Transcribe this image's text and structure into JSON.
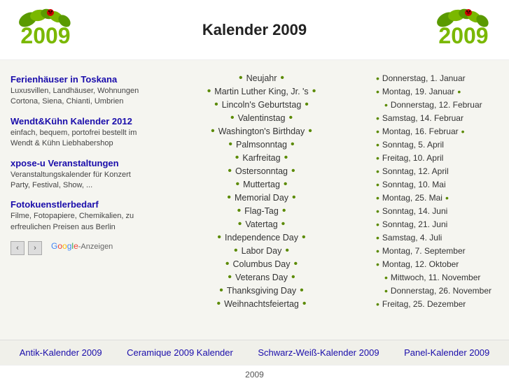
{
  "header": {
    "title": "Kalender 2009"
  },
  "sidebar": {
    "ads": [
      {
        "link": "Ferienhäuser in Toskana",
        "text": "Luxusvillen, Landhäuser, Wohnungen Cortona, Siena, Chianti, Umbrien",
        "url": "#"
      },
      {
        "link": "Wendt&Kühn Kalender 2012",
        "text": "einfach, bequem, portofrei bestellt im Wendt & Kühn Liebhabershop",
        "url": "#"
      },
      {
        "link": "xpose-u Veranstaltungen",
        "text": "Veranstaltungskalender für Konzert Party, Festival, Show, ...",
        "url": "#"
      },
      {
        "link": "Fotokuenstlerbedarf",
        "text": "Filme, Fotopapiere, Chemikalien, zu erfreulichen Preisen aus Berlin",
        "url": "#"
      }
    ],
    "google_anzeigen": "Google-Anzeigen",
    "nav_prev": "‹",
    "nav_next": "›"
  },
  "middle": {
    "holidays": [
      "Neujahr",
      "Martin Luther King, Jr. 's",
      "Lincoln's Geburtstag",
      "Valentinstag",
      "Washington's Birthday",
      "Palmsonntag",
      "Karfreitag",
      "Ostersonntag",
      "Muttertag",
      "Memorial Day",
      "Flag-Tag",
      "Vatertag",
      "Independence Day",
      "Labor Day",
      "Columbus Day",
      "Veterans Day",
      "Thanksgiving Day",
      "Weihnachtsfeiertag"
    ]
  },
  "right": {
    "dates": [
      {
        "text": "Donnerstag, 1. Januar",
        "indent": false,
        "bullet_right": false
      },
      {
        "text": "Montag, 19. Januar",
        "indent": false,
        "bullet_right": true
      },
      {
        "text": "Donnerstag, 12. Februar",
        "indent": true,
        "bullet_right": false
      },
      {
        "text": "Samstag, 14. Februar",
        "indent": false,
        "bullet_right": false
      },
      {
        "text": "Montag, 16. Februar",
        "indent": false,
        "bullet_right": true
      },
      {
        "text": "Sonntag, 5. April",
        "indent": false,
        "bullet_right": false
      },
      {
        "text": "Freitag, 10. April",
        "indent": false,
        "bullet_right": false
      },
      {
        "text": "Sonntag, 12. April",
        "indent": false,
        "bullet_right": false
      },
      {
        "text": "Sonntag, 10. Mai",
        "indent": false,
        "bullet_right": false
      },
      {
        "text": "Montag, 25. Mai",
        "indent": false,
        "bullet_right": true
      },
      {
        "text": "Sonntag, 14. Juni",
        "indent": false,
        "bullet_right": false
      },
      {
        "text": "Sonntag, 21. Juni",
        "indent": false,
        "bullet_right": false
      },
      {
        "text": "Samstag, 4. Juli",
        "indent": false,
        "bullet_right": false
      },
      {
        "text": "Montag, 7. September",
        "indent": false,
        "bullet_right": false
      },
      {
        "text": "Montag, 12. Oktober",
        "indent": false,
        "bullet_right": false
      },
      {
        "text": "Mittwoch, 11. November",
        "indent": true,
        "bullet_right": false
      },
      {
        "text": "Donnerstag, 26. November",
        "indent": true,
        "bullet_right": false
      },
      {
        "text": "Freitag, 25. Dezember",
        "indent": false,
        "bullet_right": false
      }
    ]
  },
  "footer": {
    "links": [
      {
        "label": "Antik-Kalender 2009",
        "url": "#"
      },
      {
        "label": "Ceramique 2009 Kalender",
        "url": "#"
      },
      {
        "label": "Schwarz-Weiß-Kalender 2009",
        "url": "#"
      },
      {
        "label": "Panel-Kalender 2009",
        "url": "#"
      }
    ]
  },
  "bottom": {
    "text": "2009"
  }
}
